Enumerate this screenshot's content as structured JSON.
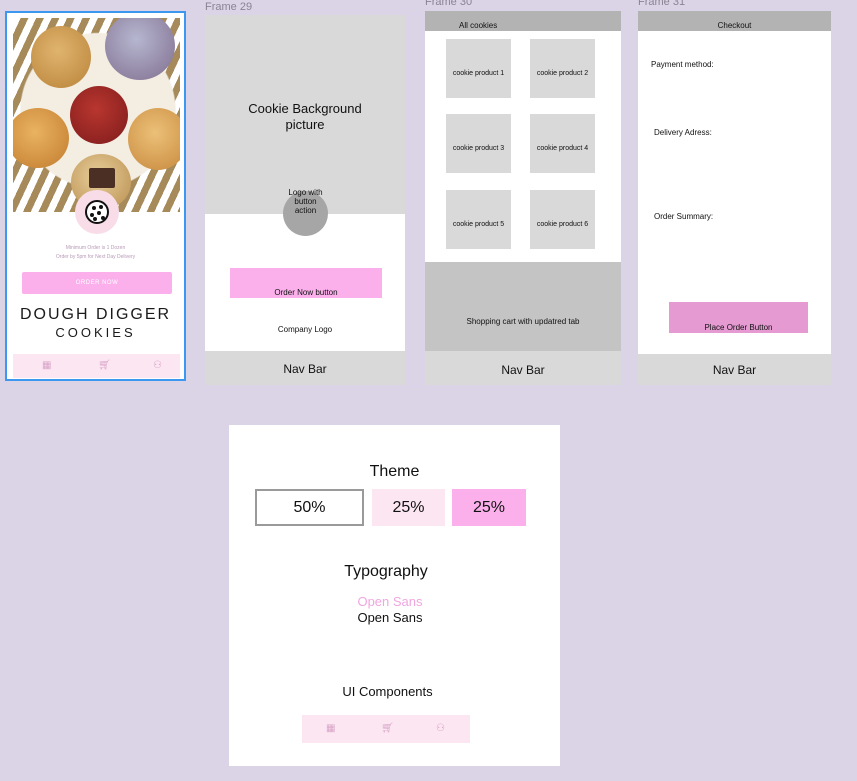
{
  "frames": {
    "frame29_label": "Frame 29",
    "frame30_label": "Frame 30",
    "frame31_label": "Frame 31"
  },
  "home": {
    "tagline_line1": "Minimum Order is 1 Dozen",
    "tagline_line2": "Order by 5pm for Next Day Delivery",
    "order_button": "ORDER NOW",
    "brand_name": "DOUGH DIGGER",
    "brand_sub": "COOKIES",
    "nav_icons": [
      "grid-icon",
      "cart-icon",
      "user-icon"
    ],
    "accent_pink": "#fbb0ec",
    "light_pink": "#fce6f2"
  },
  "frame29": {
    "background_text": "Cookie Background picture",
    "logo_text": "Logo with button action",
    "order_button_text": "Order Now button",
    "company_logo_text": "Company Logo",
    "nav_bar": "Nav Bar"
  },
  "frame30": {
    "header": "All cookies",
    "products": [
      "cookie product 1",
      "cookie product 2",
      "cookie product 3",
      "cookie product 4",
      "cookie product 5",
      "cookie product 6"
    ],
    "cart_text": "Shopping cart with updatred tab",
    "nav_bar": "Nav Bar"
  },
  "frame31": {
    "header": "Checkout",
    "payment": "Payment method:",
    "delivery": "Delivery Adress:",
    "summary": "Order Summary:",
    "place_order": "Place Order Button",
    "nav_bar": "Nav Bar"
  },
  "board": {
    "theme_title": "Theme",
    "swatches": [
      "50%",
      "25%",
      "25%"
    ],
    "swatch_colors": [
      "#ffffff",
      "#fce6f2",
      "#fbb0ec"
    ],
    "typography_title": "Typography",
    "font_sample_pink": "Open Sans",
    "font_sample_black": "Open Sans",
    "components_title": "UI Components"
  }
}
